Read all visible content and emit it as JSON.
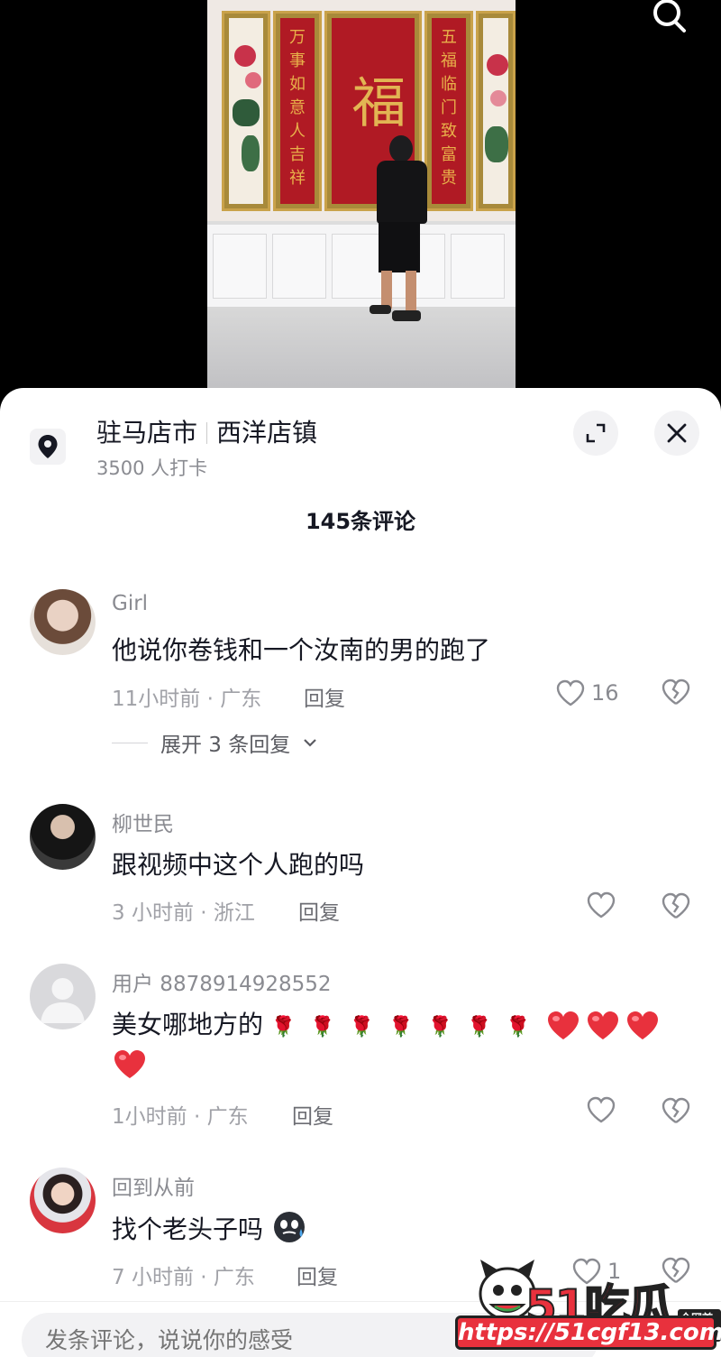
{
  "location": {
    "city": "驻马店市",
    "town": "西洋店镇",
    "checkins": "3500 人打卡"
  },
  "comments_header": "145条评论",
  "comments": [
    {
      "name": "Girl",
      "text": "他说你卷钱和一个汝南的男的跑了",
      "meta": "11小时前 · 广东",
      "reply_label": "回复",
      "likes": "16",
      "expand_label": "展开 3 条回复"
    },
    {
      "name": "柳世民",
      "text": "跟视频中这个人跑的吗",
      "meta": "3 小时前 · 浙江",
      "reply_label": "回复"
    },
    {
      "name": "用户 8878914928552",
      "text": "美女哪地方的",
      "emoji_roses": 7,
      "emoji_hearts": 4,
      "meta": "1小时前 · 广东",
      "reply_label": "回复"
    },
    {
      "name": "回到从前",
      "text": "找个老头子吗",
      "meta": "7 小时前 · 广东",
      "reply_label": "回复",
      "likes": "1"
    }
  ],
  "input": {
    "placeholder": "发条评论，说说你的感受"
  },
  "watermark": {
    "title": "51吃瓜",
    "badge": "全网首发",
    "url": "https://51cgf13.com"
  },
  "video_text": {
    "left_couplet": "万事如意人吉祥",
    "right_couplet": "五福临门致富贵",
    "center_char": "福"
  },
  "colors": {
    "accent": "#fe2c55",
    "watermark_red": "#e8313d",
    "text_primary": "#161823",
    "text_secondary": "#8a8b91"
  }
}
